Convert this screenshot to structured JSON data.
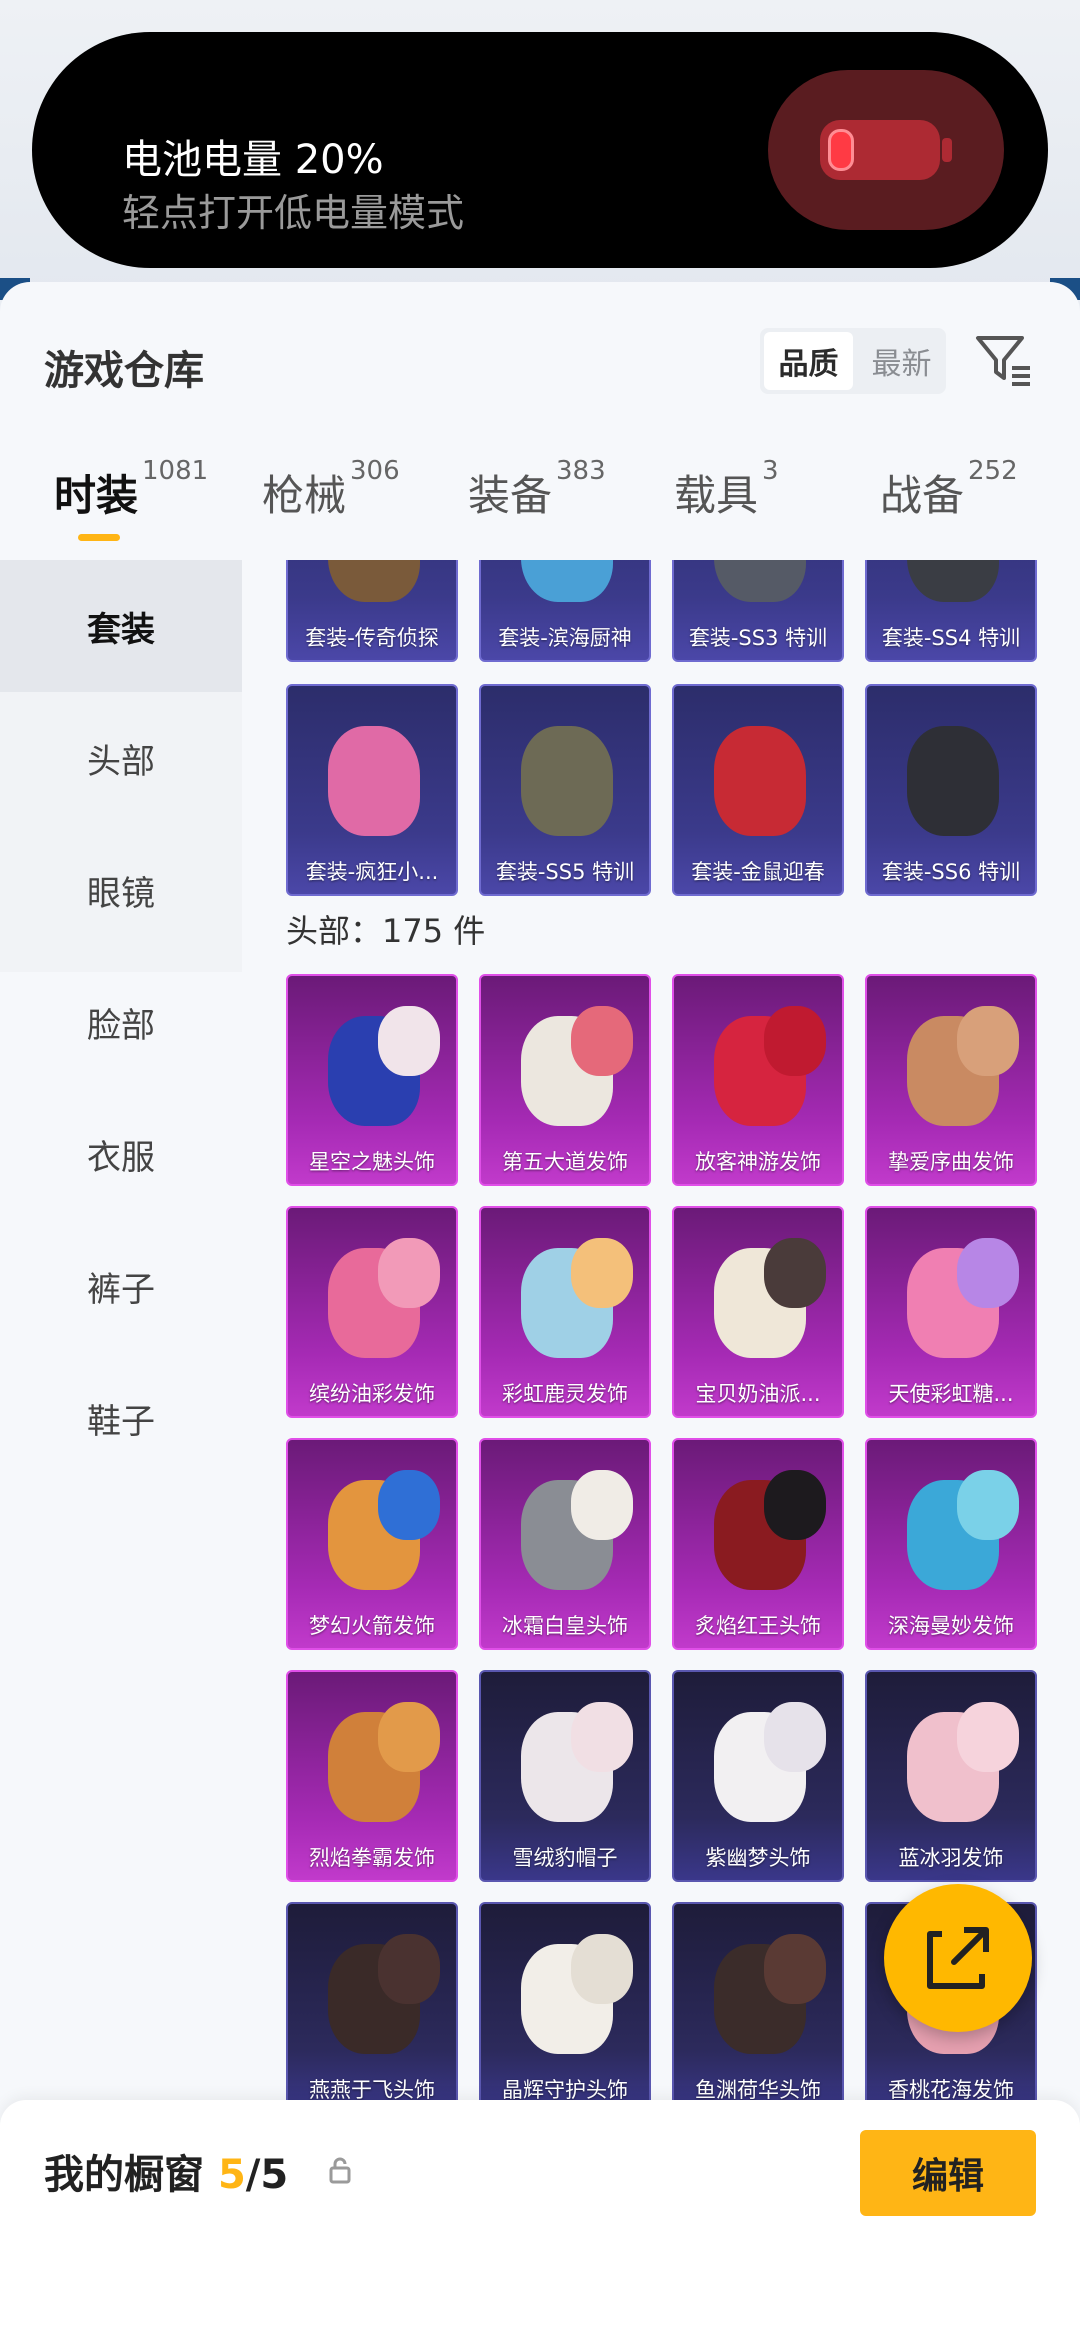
{
  "battery": {
    "title": "电池电量 20%",
    "subtitle": "轻点打开低电量模式",
    "level_percent": 20
  },
  "header": {
    "title": "游戏仓库",
    "sort": {
      "options": [
        "品质",
        "最新"
      ],
      "selected": "品质"
    }
  },
  "tabs": [
    {
      "label": "时装",
      "count": "1081",
      "active": true
    },
    {
      "label": "枪械",
      "count": "306",
      "active": false
    },
    {
      "label": "装备",
      "count": "383",
      "active": false
    },
    {
      "label": "载具",
      "count": "3",
      "active": false
    },
    {
      "label": "战备",
      "count": "252",
      "active": false
    }
  ],
  "sidenav": [
    {
      "label": "套装",
      "active": true
    },
    {
      "label": "头部",
      "active": false
    },
    {
      "label": "眼镜",
      "active": false
    },
    {
      "label": "脸部",
      "active": false
    },
    {
      "label": "衣服",
      "active": false
    },
    {
      "label": "裤子",
      "active": false
    },
    {
      "label": "鞋子",
      "active": false
    }
  ],
  "suits": [
    {
      "label": "套装-传奇侦探",
      "color": "purple"
    },
    {
      "label": "套装-滨海厨神",
      "color": "purple"
    },
    {
      "label": "套装-SS3 特训",
      "color": "purple"
    },
    {
      "label": "套装-SS4 特训",
      "color": "purple"
    },
    {
      "label": "套装-疯狂小...",
      "color": "purple"
    },
    {
      "label": "套装-SS5 特训",
      "color": "purple"
    },
    {
      "label": "套装-金鼠迎春",
      "color": "purple"
    },
    {
      "label": "套装-SS6 特训",
      "color": "purple"
    }
  ],
  "head_section": {
    "label": "头部：175 件",
    "items": [
      {
        "label": "星空之魅头饰",
        "color": "pink"
      },
      {
        "label": "第五大道发饰",
        "color": "pink"
      },
      {
        "label": "放客神游发饰",
        "color": "pink"
      },
      {
        "label": "挚爱序曲发饰",
        "color": "pink"
      },
      {
        "label": "缤纷油彩发饰",
        "color": "pink"
      },
      {
        "label": "彩虹鹿灵发饰",
        "color": "pink"
      },
      {
        "label": "宝贝奶油派...",
        "color": "pink"
      },
      {
        "label": "天使彩虹糖...",
        "color": "pink"
      },
      {
        "label": "梦幻火箭发饰",
        "color": "pink"
      },
      {
        "label": "冰霜白皇头饰",
        "color": "pink"
      },
      {
        "label": "炙焰红王头饰",
        "color": "pink"
      },
      {
        "label": "深海曼妙发饰",
        "color": "pink"
      },
      {
        "label": "烈焰拳霸发饰",
        "color": "pink"
      },
      {
        "label": "雪绒豹帽子",
        "color": "dark"
      },
      {
        "label": "紫幽梦头饰",
        "color": "dark"
      },
      {
        "label": "蓝冰羽发饰",
        "color": "dark"
      },
      {
        "label": "燕燕于飞头饰",
        "color": "dark"
      },
      {
        "label": "晶辉守护头饰",
        "color": "dark"
      },
      {
        "label": "鱼渊荷华头饰",
        "color": "dark"
      },
      {
        "label": "香桃花海发饰",
        "color": "dark"
      }
    ]
  },
  "showcase": {
    "label": "我的橱窗",
    "used": "5",
    "separator_total": "/5",
    "edit_label": "编辑"
  },
  "icons": {
    "filter": "filter-icon",
    "share": "share-icon",
    "lock": "lock-icon"
  },
  "colors": {
    "accent": "#ffb515",
    "card_purple": "#3b3a8b",
    "card_pink": "#a52ab4",
    "card_dark": "#2c2a5c"
  }
}
